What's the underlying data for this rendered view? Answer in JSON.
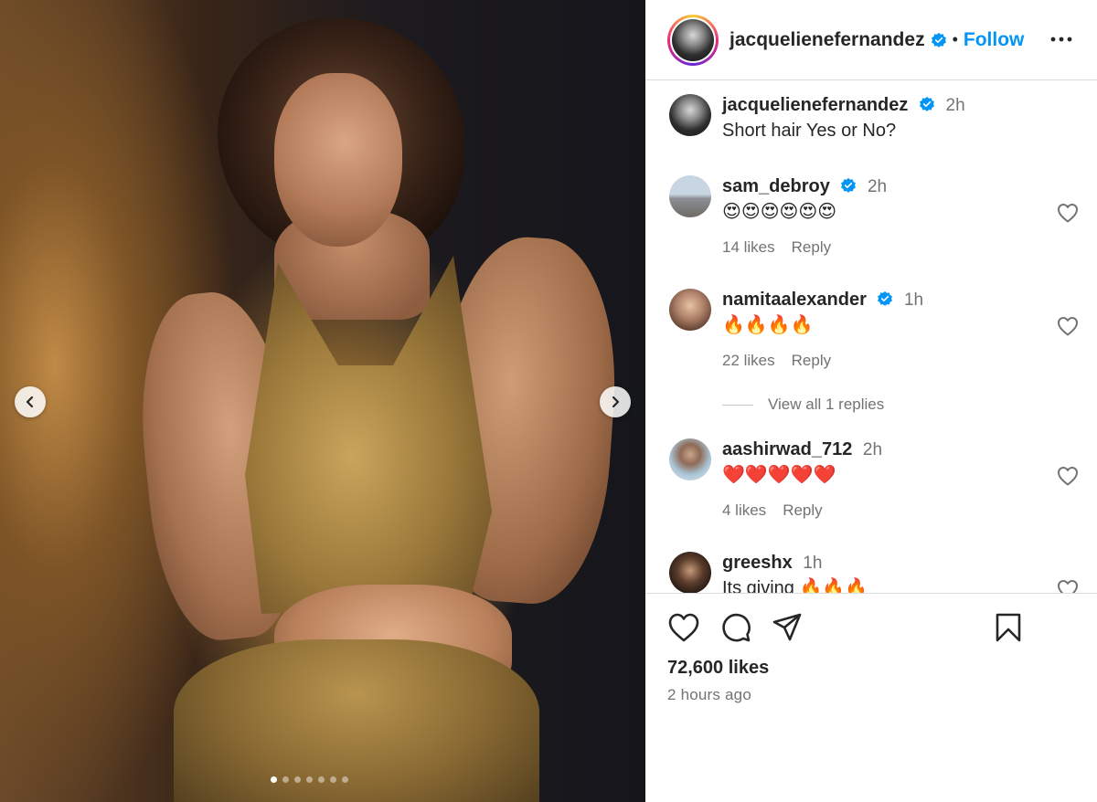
{
  "post": {
    "author": "jacquelienefernandez",
    "follow_label": "Follow",
    "separator": "•",
    "caption_time": "2h",
    "caption_text": "Short hair Yes or No?",
    "likes": "72,600 likes",
    "posted": "2 hours ago",
    "carousel": {
      "total_slides": 7,
      "active_slide": 1
    }
  },
  "comments": [
    {
      "username": "sam_debroy",
      "verified": true,
      "time": "2h",
      "text": "😍😍😍😍😍😍",
      "likes": "14 likes",
      "reply_label": "Reply"
    },
    {
      "username": "namitaalexander",
      "verified": true,
      "time": "1h",
      "text": "🔥🔥🔥🔥",
      "likes": "22 likes",
      "reply_label": "Reply"
    },
    {
      "username": "aashirwad_712",
      "verified": false,
      "time": "2h",
      "text": "❤️❤️❤️❤️❤️",
      "likes": "4 likes",
      "reply_label": "Reply"
    },
    {
      "username": "greeshx",
      "verified": false,
      "time": "1h",
      "text": "Its giving 🔥🔥🔥"
    }
  ],
  "view_replies_label": "View all 1 replies",
  "icons": {
    "verified": "verified-badge-icon",
    "more": "more-options-icon",
    "heart": "heart-icon",
    "comment": "comment-icon",
    "share": "share-icon",
    "bookmark": "bookmark-icon",
    "prev": "chevron-left-icon",
    "next": "chevron-right-icon"
  },
  "colors": {
    "accent": "#0095f6",
    "verified": "#0095f6",
    "text": "#262626",
    "muted": "#737373"
  }
}
